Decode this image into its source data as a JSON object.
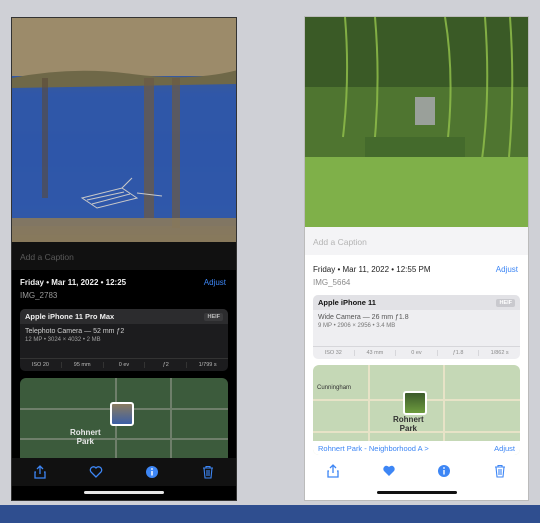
{
  "left": {
    "caption_placeholder": "Add a Caption",
    "date": "Friday • Mar 11, 2022 • 12:25",
    "adjust": "Adjust",
    "filename": "IMG_2783",
    "device": "Apple iPhone 11 Pro Max",
    "format": "HEIF",
    "lens": "Telephoto Camera — 52 mm ƒ2",
    "specs": "12 MP • 3024 × 4032 • 2 MB",
    "exif": [
      "ISO 20",
      "95 mm",
      "0 ev",
      "ƒ2",
      "1/799 s"
    ],
    "map_place": "Rohnert\nPark",
    "toolbar": [
      "share-icon",
      "heart-outline-icon",
      "info-icon",
      "trash-icon"
    ]
  },
  "right": {
    "caption_placeholder": "Add a Caption",
    "date": "Friday • Mar 11, 2022 • 12:55 PM",
    "adjust": "Adjust",
    "filename": "IMG_5664",
    "device": "Apple iPhone 11",
    "format": "HEIF",
    "lens": "Wide Camera — 26 mm ƒ1.8",
    "specs": "9 MP • 2906 × 2956 • 3.4 MB",
    "exif": [
      "ISO 32",
      "43 mm",
      "0 ev",
      "ƒ1.8",
      "1/862 s"
    ],
    "map_town": "Cunningham",
    "map_place": "Rohnert\nPark",
    "location_label": "Rohnert Park - Neighborhood A >",
    "location_adjust": "Adjust",
    "toolbar": [
      "share-icon",
      "heart-filled-icon",
      "info-icon",
      "trash-icon"
    ]
  },
  "colors": {
    "accent": "#3d86f5",
    "bottom_band": "#2f4e8f"
  }
}
